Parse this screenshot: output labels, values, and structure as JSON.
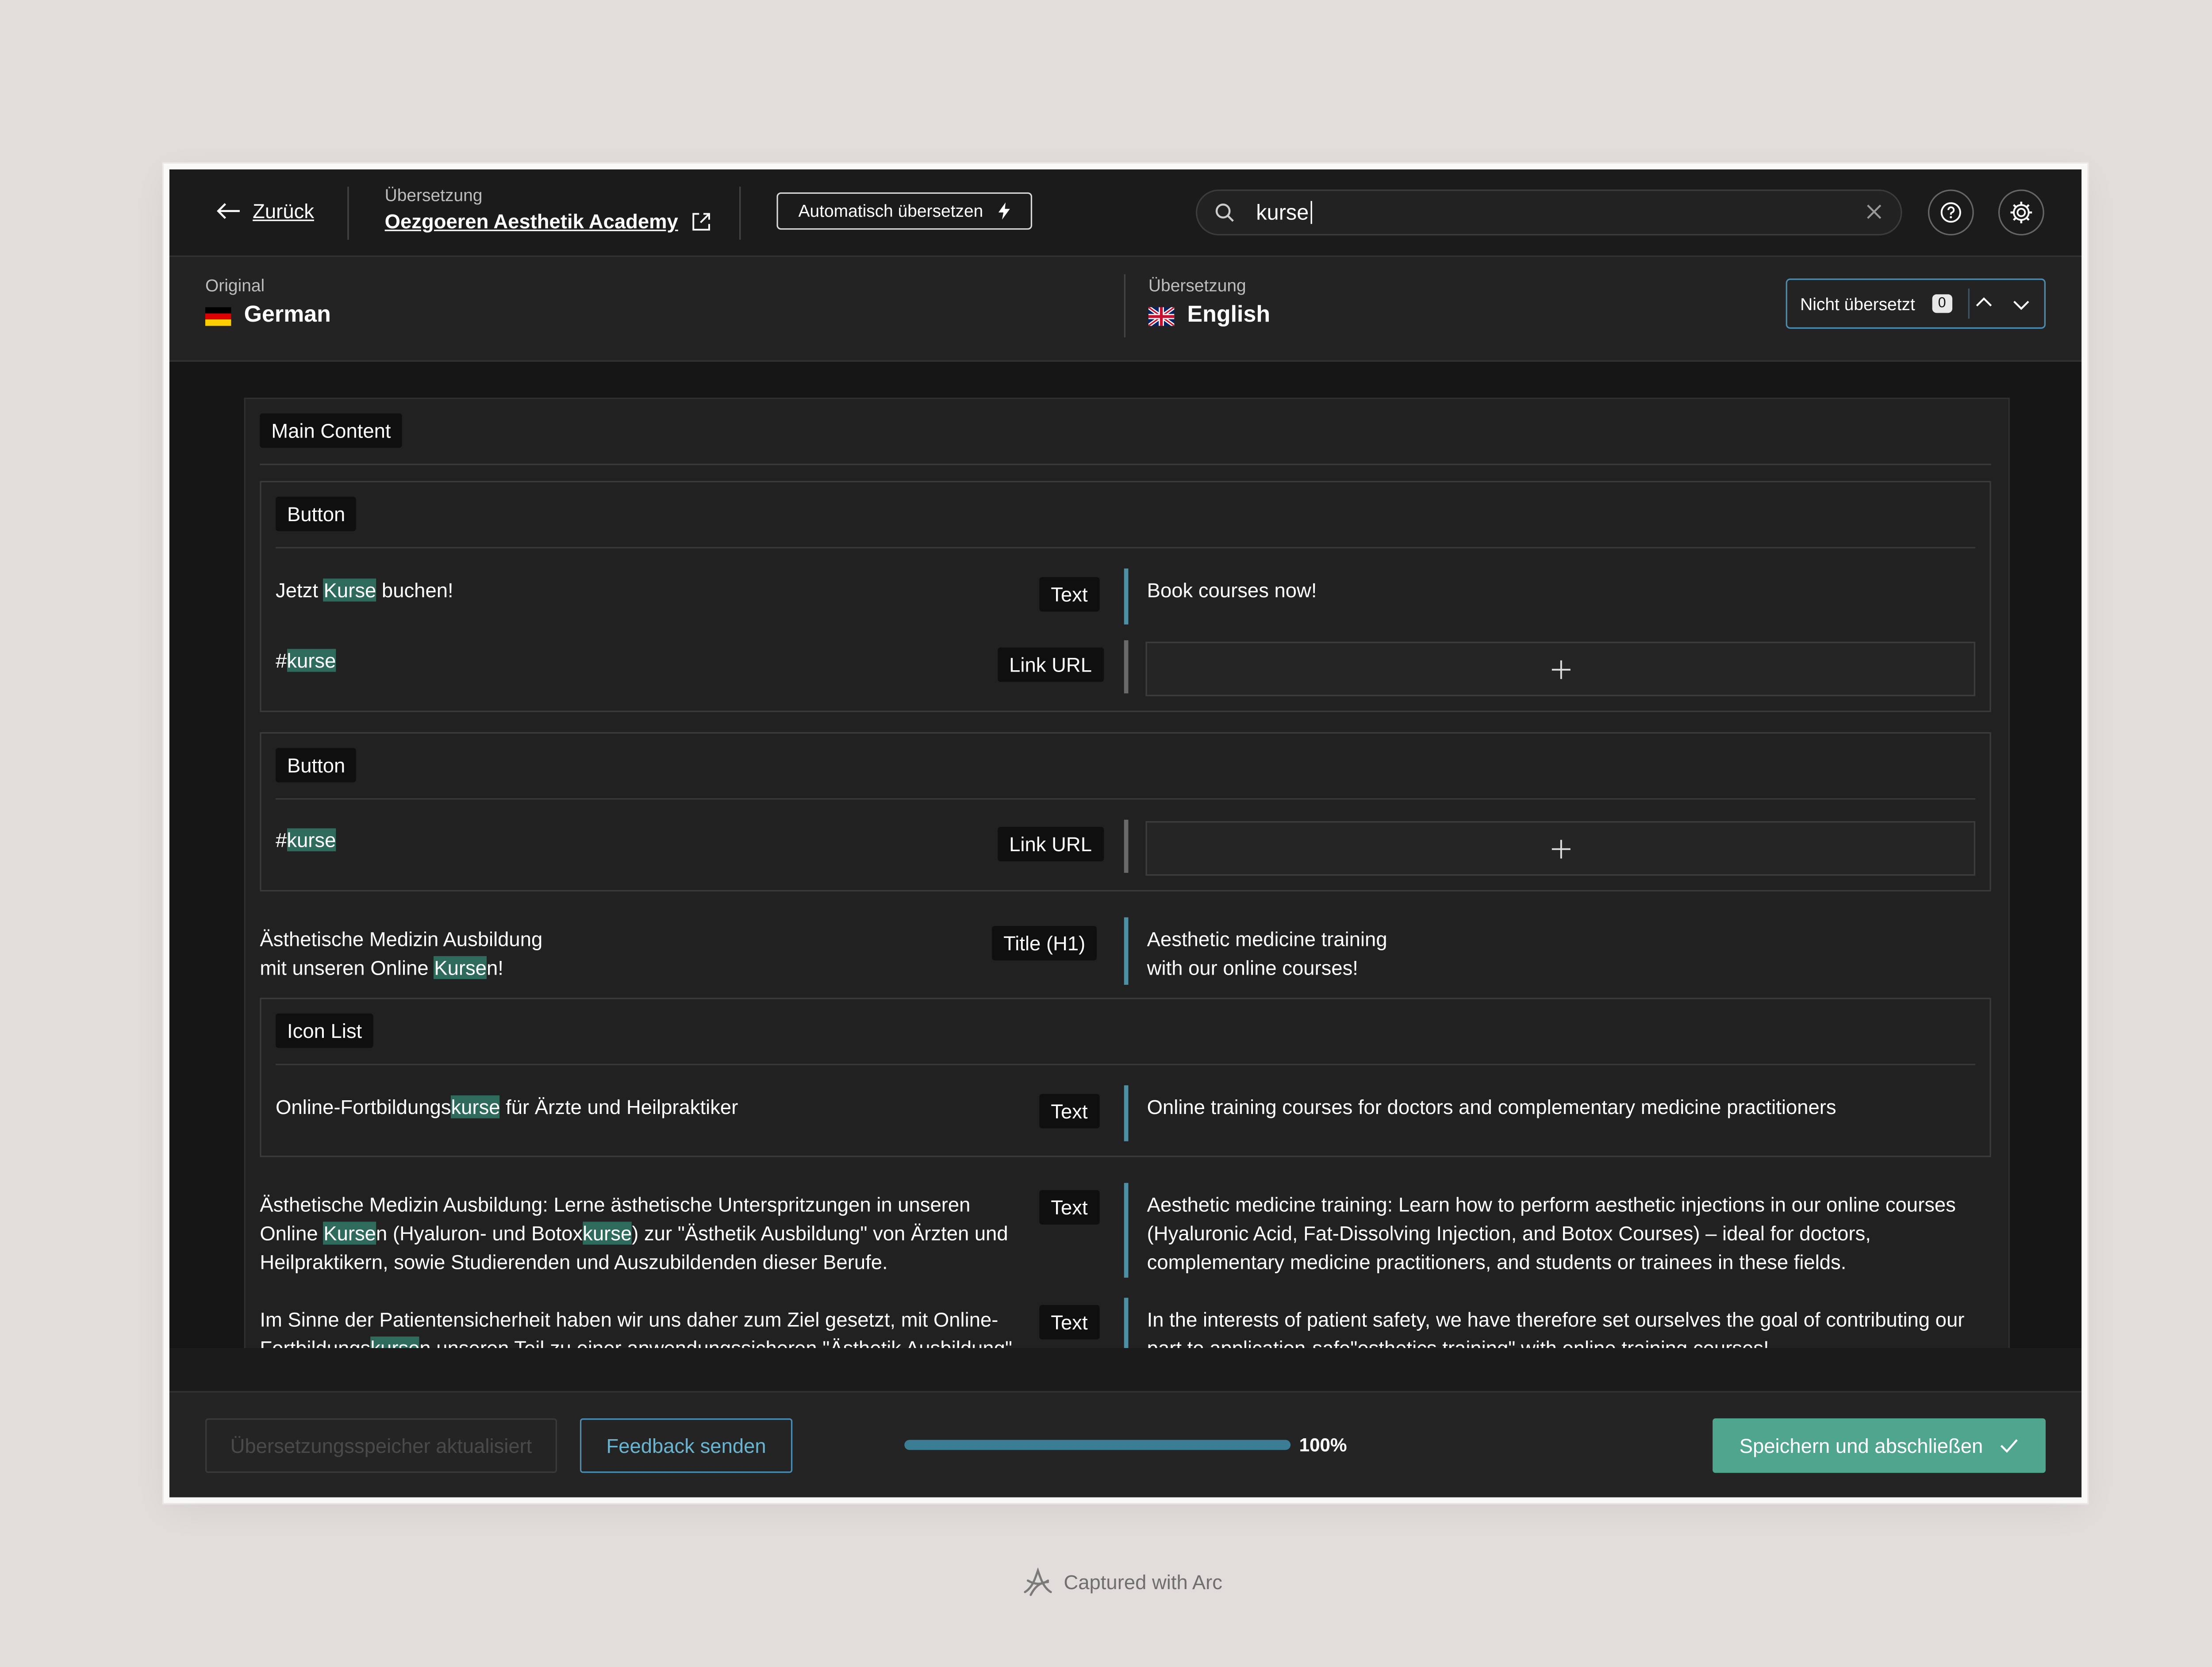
{
  "header": {
    "back_label": "Zurück",
    "crumb_small": "Übersetzung",
    "site_name": "Oezgoeren Aesthetik Academy",
    "auto_translate_label": "Automatisch übersetzen",
    "search_value": "kurse"
  },
  "languages": {
    "original_label": "Original",
    "original_name": "German",
    "translation_label": "Übersetzung",
    "translation_name": "English",
    "filter_label": "Nicht übersetzt",
    "filter_count": "0"
  },
  "content": {
    "main_section": "Main Content",
    "button_group_1": {
      "title": "Button",
      "row1": {
        "pre": "Jetzt ",
        "hl": "Kurse",
        "post": " buchen!",
        "type": "Text",
        "translation": "Book courses now!"
      },
      "row2": {
        "pre": "#",
        "hl": "kurse",
        "type": "Link URL"
      }
    },
    "button_group_2": {
      "title": "Button",
      "row1": {
        "pre": "#",
        "hl": "kurse",
        "type": "Link URL"
      }
    },
    "title_row": {
      "line1": "Ästhetische Medizin Ausbildung",
      "line2_pre": "mit unseren Online ",
      "line2_hl": "Kurse",
      "line2_post": "n!",
      "type": "Title (H1)",
      "translation_line1": "Aesthetic medicine training",
      "translation_line2": "with our online courses!"
    },
    "icon_list": {
      "title": "Icon List",
      "row1": {
        "pre": "Online-Fortbildungs",
        "hl": "kurse",
        "post": " für Ärzte und Heilpraktiker",
        "type": "Text",
        "translation": "Online training courses for doctors and complementary medicine practitioners"
      }
    },
    "para1": {
      "line1": "Ästhetische Medizin Ausbildung: Lerne ästhetische Unterspritzungen in unseren",
      "line2_a": "Online ",
      "line2_hl1": "Kurse",
      "line2_b": "n (Hyaluron- und Botox",
      "line2_hl2": "kurse",
      "line2_c": ") zur \"Ästhetik Ausbildung\" von Ärzten und",
      "line3": "Heilpraktikern, sowie Studierenden und Auszubildenden dieser Berufe.",
      "type": "Text",
      "tr_line1": "Aesthetic medicine training: Learn how to perform aesthetic injections in our online courses",
      "tr_line2": "(Hyaluronic Acid, Fat-Dissolving Injection, and Botox Courses) – ideal for doctors,",
      "tr_line3": "complementary medicine practitioners, and students or trainees in these fields."
    },
    "para2": {
      "line1": "Im Sinne der Patientensicherheit haben wir uns daher zum Ziel gesetzt, mit Online-",
      "line2_a": "Fortbildungs",
      "line2_hl": "kurse",
      "line2_b": "n unseren Teil zu einer anwendungssicheren \"Ästhetik Ausbildung\"",
      "type": "Text",
      "tr_line1": "In the interests of patient safety, we have therefore set ourselves the goal of contributing our",
      "tr_line2": "part to application-safe\"esthetics training\" with online training courses!"
    }
  },
  "footer": {
    "memory_label": "Übersetzungsspeicher aktualisiert",
    "feedback_label": "Feedback senden",
    "progress_percent": 100,
    "progress_label": "100%",
    "save_label": "Speichern und abschließen"
  },
  "watermark": "Captured with Arc",
  "colors": {
    "accent_teal": "#4fa58e",
    "highlight": "#2e6b5c",
    "progress": "#3b7d94",
    "border_blue": "#4c8bb2"
  }
}
